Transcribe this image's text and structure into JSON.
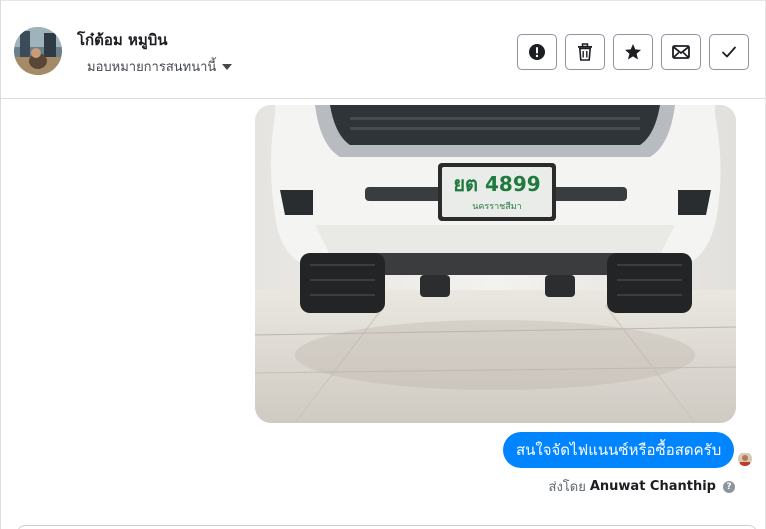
{
  "header": {
    "contact_name": "โก๋ต้อม หมูบิน",
    "assign_label": "มอบหมายการสนทนานี้",
    "avatar_icon": "profile-photo",
    "buttons": [
      {
        "name": "spam",
        "icon": "exclamation-circle-icon"
      },
      {
        "name": "delete",
        "icon": "trash-icon"
      },
      {
        "name": "star",
        "icon": "star-icon"
      },
      {
        "name": "mark-unread",
        "icon": "envelope-icon"
      },
      {
        "name": "mark-done",
        "icon": "checkmark-icon"
      }
    ]
  },
  "message": {
    "image_plate_text": "ยต 4899",
    "image_plate_province": "นครราชสีมา",
    "text": "สนใจจัดไฟแนนซ์หรือซื้อสดครับ",
    "sent_by_prefix": "ส่งโดย",
    "sent_by_name": "Anuwat Chanthip",
    "help_symbol": "?"
  },
  "colors": {
    "bubble": "#0084ff",
    "border": "#8d949e",
    "text": "#1c1e21"
  }
}
